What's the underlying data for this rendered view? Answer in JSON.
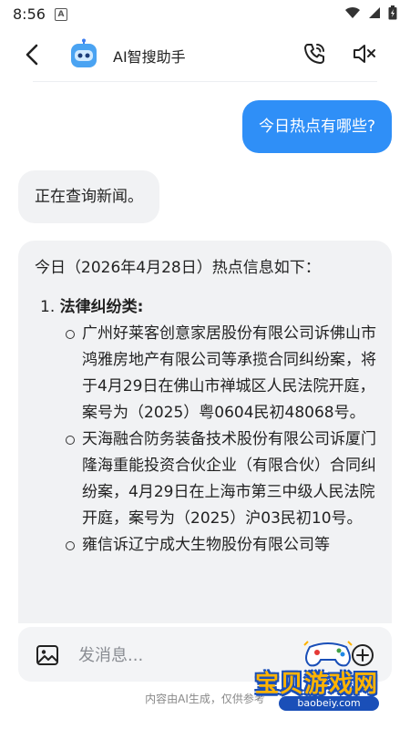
{
  "status_bar": {
    "time": "8:56",
    "notification_glyph": "A",
    "icons": [
      "wifi-icon",
      "signal-icon",
      "battery-icon"
    ]
  },
  "header": {
    "title": "AI智搜助手",
    "icons": [
      "back-arrow-icon",
      "robot-avatar-icon",
      "phone-call-icon",
      "speaker-muted-icon"
    ]
  },
  "messages": {
    "user_question": "今日热点有哪些?",
    "bot_status": "正在查询新闻。",
    "bot_answer": {
      "intro": "今日（2026年4月28日）热点信息如下：",
      "category_number": "1.",
      "category_title": "法律纠纷类:",
      "items": [
        "广州好莱客创意家居股份有限公司诉佛山市鸿雅房地产有限公司等承揽合同纠纷案，将于4月29日在佛山市禅城区人民法院开庭，案号为（2025）粤0604民初48068号。",
        "天海融合防务装备技术股份有限公司诉厦门隆海重能投资合伙企业（有限合伙）合同纠纷案，4月29日在上海市第三中级人民法院开庭，案号为（2025）沪03民初10号。",
        "雍信诉辽宁成大生物股份有限公司等"
      ]
    }
  },
  "composer": {
    "placeholder": "发消息...",
    "icons": [
      "image-icon",
      "plus-circle-icon"
    ]
  },
  "footer": {
    "disclaimer": "内容由AI生成，仅供参考"
  },
  "watermark": {
    "title": "宝贝游戏网",
    "url": "baobeiy.com"
  },
  "colors": {
    "accent": "#2f8ff7",
    "bubble_gray": "#f1f2f4",
    "watermark_yellow": "#ffb300",
    "watermark_blue": "#1a4fb8"
  }
}
